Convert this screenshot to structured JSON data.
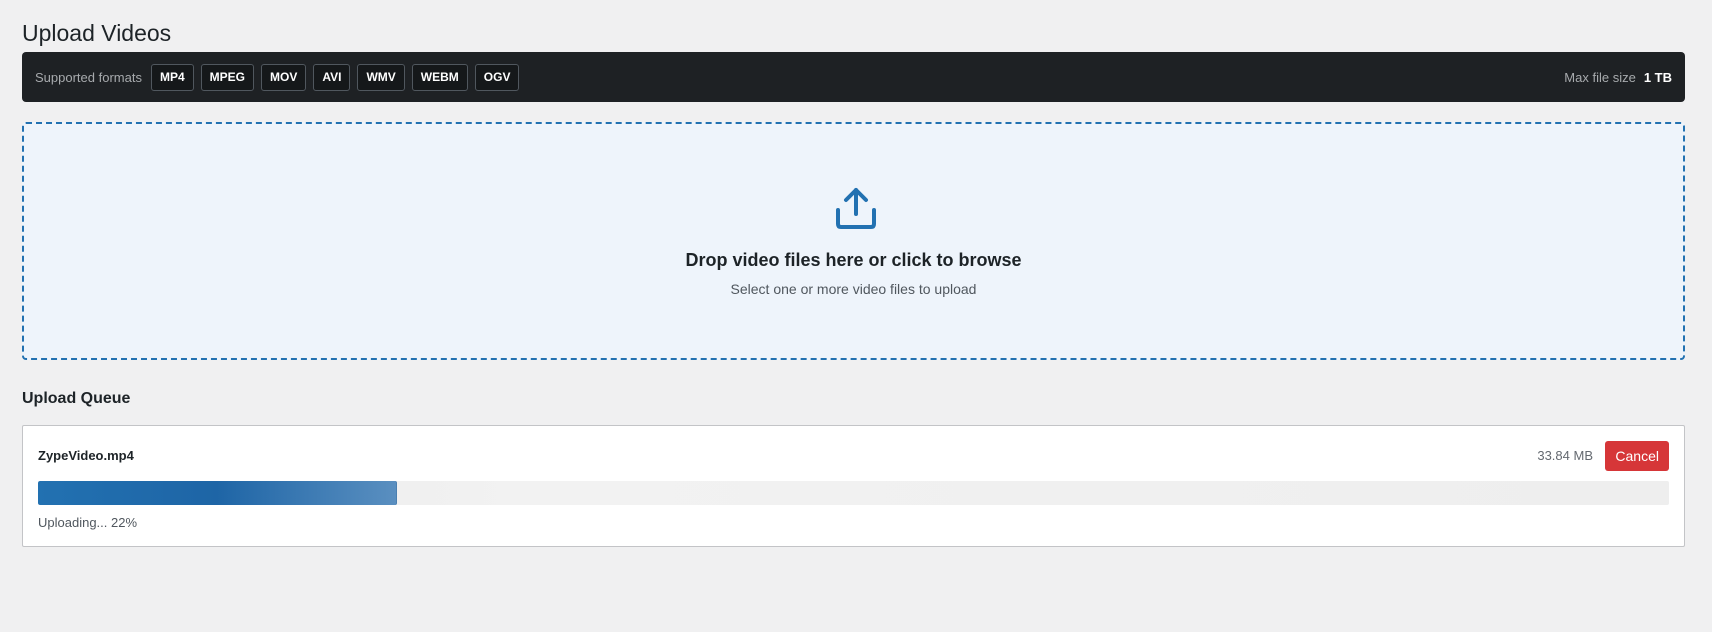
{
  "page": {
    "title": "Upload Videos"
  },
  "formats": {
    "label": "Supported formats",
    "items": [
      "MP4",
      "MPEG",
      "MOV",
      "AVI",
      "WMV",
      "WEBM",
      "OGV"
    ],
    "max_size_label": "Max file size",
    "max_size_value": "1 TB"
  },
  "dropzone": {
    "icon": "upload-icon",
    "title": "Drop video files here or click to browse",
    "subtitle": "Select one or more video files to upload"
  },
  "queue": {
    "title": "Upload Queue",
    "items": [
      {
        "file_name": "ZypeVideo.mp4",
        "file_size": "33.84 MB",
        "cancel_label": "Cancel",
        "progress": 0.22,
        "status": "Uploading... 22%"
      }
    ]
  },
  "colors": {
    "accent": "#2271b1",
    "danger": "#d63638",
    "bar_bg": "#1e2124",
    "page_bg": "#f0f0f1"
  }
}
